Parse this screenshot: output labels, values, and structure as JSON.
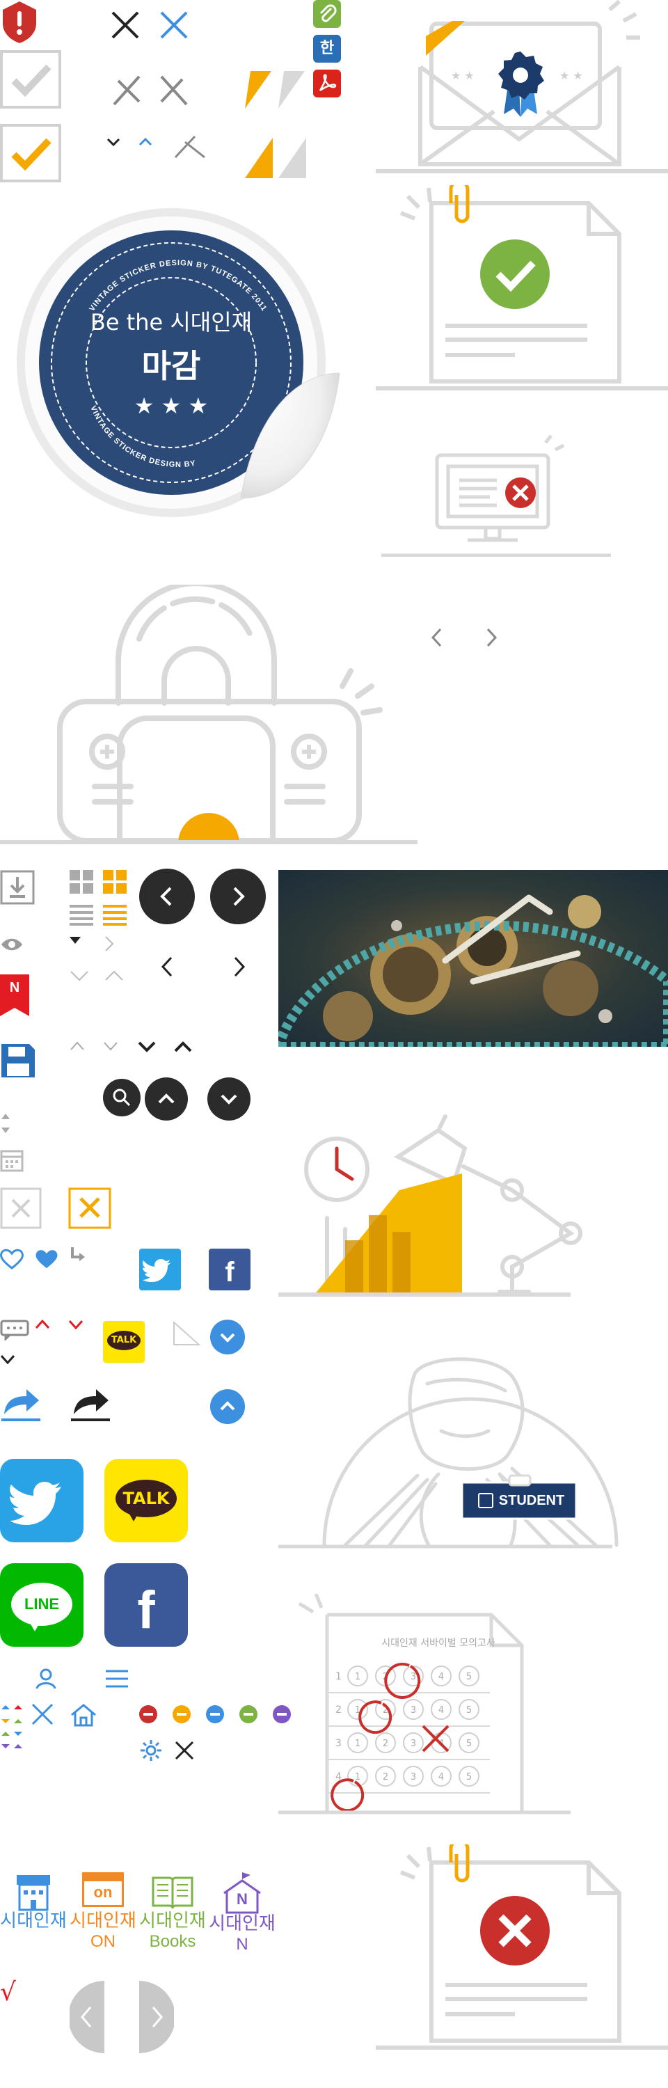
{
  "colors": {
    "gray_line": "#d9d9d9",
    "gray_icon": "#9a9a9a",
    "dark": "#222222",
    "orange": "#f5a800",
    "yellow": "#ffd200",
    "red": "#c9302c",
    "green": "#8bc34a",
    "blue": "#2a6fb5",
    "navy": "#1c3b6b",
    "twitter": "#2aa3e6",
    "kakao": "#ffe500",
    "line": "#00b900",
    "facebook": "#3b5998"
  },
  "sticker": {
    "ring_text_top": "VINTAGE STICKER DESIGN  BY TUTEGATE 2011",
    "ring_text_bottom": "VINTAGE STICKER DESIGN  BY",
    "line1": "Be the 시대인재",
    "line2": "마감",
    "stars": "★ ★ ★"
  },
  "icons": {
    "n_badge": "N",
    "talk_small": "TALK",
    "talk_large": "TALK",
    "line_logo": "LINE",
    "facebook_f": "f",
    "naver_n": "N",
    "hangul_badge": "한"
  },
  "student_badge": "STUDENT",
  "omr": {
    "title": "시대인재 서바이벌 모의고사",
    "rows": [
      "1",
      "2",
      "3",
      "4"
    ],
    "options": [
      "1",
      "2",
      "3",
      "4",
      "5"
    ]
  },
  "brands": [
    {
      "name": "시대인재",
      "sub": "",
      "color": "#3d8fe0",
      "icon": "building-icon"
    },
    {
      "name": "시대인재",
      "sub": "ON",
      "color": "#f08a24",
      "icon": "on-screen-icon"
    },
    {
      "name": "시대인재",
      "sub": "Books",
      "color": "#7cb342",
      "icon": "book-icon"
    },
    {
      "name": "시대인재",
      "sub": "N",
      "color": "#7e57c2",
      "icon": "school-icon"
    }
  ],
  "on_label": "on",
  "check_mark": "√"
}
